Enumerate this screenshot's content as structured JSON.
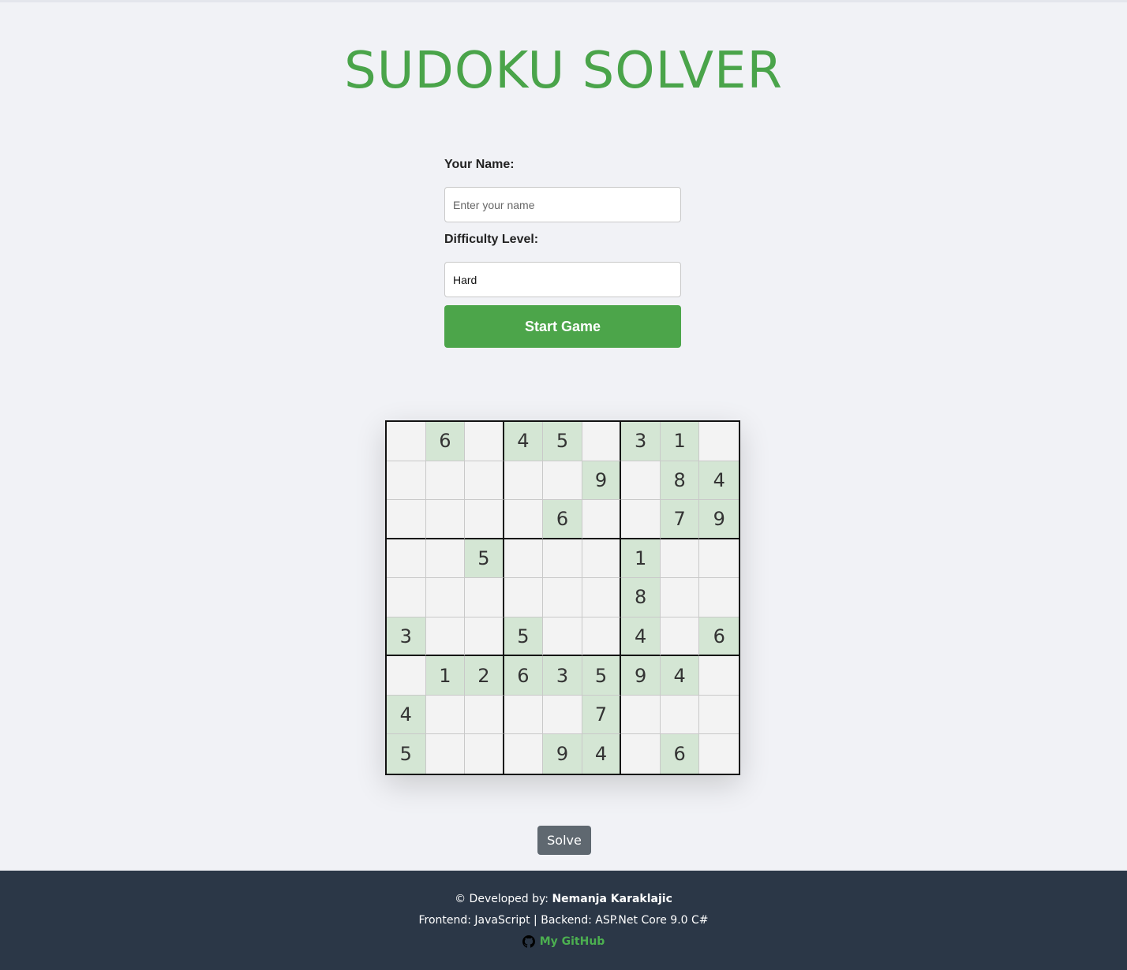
{
  "header": {
    "title": "SUDOKU SOLVER"
  },
  "form": {
    "name_label": "Your Name:",
    "name_value": "",
    "name_placeholder": "Enter your name",
    "difficulty_label": "Difficulty Level:",
    "difficulty_value": "Hard",
    "start_button": "Start Game"
  },
  "board": {
    "rows": [
      [
        "",
        "6",
        "",
        "4",
        "5",
        "",
        "3",
        "1",
        ""
      ],
      [
        "",
        "",
        "",
        "",
        "",
        "9",
        "",
        "8",
        "4"
      ],
      [
        "",
        "",
        "",
        "",
        "6",
        "",
        "",
        "7",
        "9"
      ],
      [
        "",
        "",
        "5",
        "",
        "",
        "",
        "1",
        "",
        ""
      ],
      [
        "",
        "",
        "",
        "",
        "",
        "",
        "8",
        "",
        ""
      ],
      [
        "3",
        "",
        "",
        "5",
        "",
        "",
        "4",
        "",
        "6"
      ],
      [
        "",
        "1",
        "2",
        "6",
        "3",
        "5",
        "9",
        "4",
        ""
      ],
      [
        "4",
        "",
        "",
        "",
        "",
        "7",
        "",
        "",
        ""
      ],
      [
        "5",
        "",
        "",
        "",
        "9",
        "4",
        "",
        "6",
        ""
      ]
    ],
    "given_color": "#d4e6d4",
    "empty_color": "#f3f3f3"
  },
  "actions": {
    "solve_button": "Solve"
  },
  "footer": {
    "dev_prefix": "© Developed by: ",
    "dev_name": "Nemanja Karaklajic",
    "tech_line": "Frontend: JavaScript | Backend: ASP.Net Core 9.0 C#",
    "github_label": "My GitHub",
    "github_icon": "github-icon"
  },
  "colors": {
    "accent": "#4aa44a",
    "footer_bg": "#2b3747",
    "solve_bg": "#5f6870",
    "page_bg": "#f1f2f6"
  }
}
